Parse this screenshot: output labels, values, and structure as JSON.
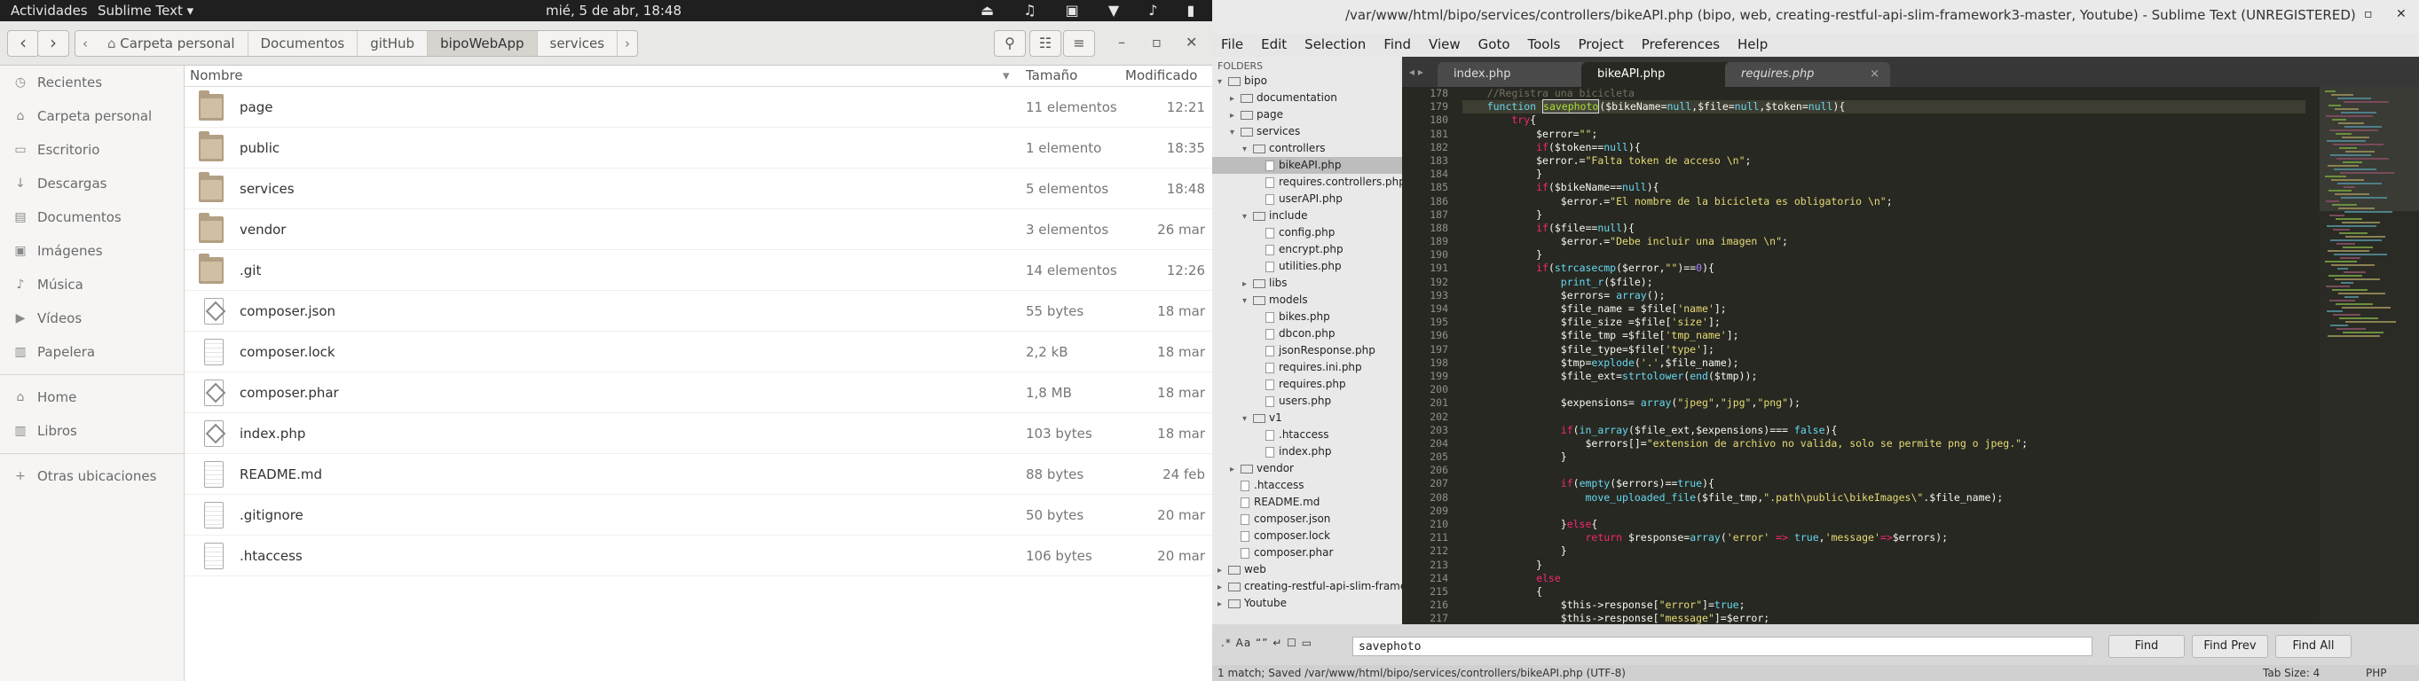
{
  "topbar": {
    "activities": "Actividades",
    "app_menu": "Sublime Text ▾",
    "clock": "mié,  5 de abr, 18:48",
    "tray_icons": [
      "bell-icon",
      "music-icon",
      "display-icon",
      "wifi-icon",
      "volume-icon",
      "battery-icon",
      "power-icon"
    ],
    "tray_glyphs": "⏏ ♫ ▣ ▼ ♪ ▮ ⏻"
  },
  "files": {
    "breadcrumbs": [
      "Carpeta personal",
      "Documentos",
      "gitHub",
      "bipoWebApp",
      "services"
    ],
    "active_crumb": "bipoWebApp",
    "sidebar": [
      {
        "icon": "clock-icon",
        "glyph": "◷",
        "label": "Recientes"
      },
      {
        "icon": "home-icon",
        "glyph": "⌂",
        "label": "Carpeta personal"
      },
      {
        "icon": "desktop-icon",
        "glyph": "▭",
        "label": "Escritorio"
      },
      {
        "icon": "download-icon",
        "glyph": "↓",
        "label": "Descargas"
      },
      {
        "icon": "document-icon",
        "glyph": "▤",
        "label": "Documentos"
      },
      {
        "icon": "image-icon",
        "glyph": "▣",
        "label": "Imágenes"
      },
      {
        "icon": "music-icon",
        "glyph": "♪",
        "label": "Música"
      },
      {
        "icon": "video-icon",
        "glyph": "▶",
        "label": "Vídeos"
      },
      {
        "icon": "trash-icon",
        "glyph": "▥",
        "label": "Papelera"
      },
      {
        "sep": true
      },
      {
        "icon": "home-icon",
        "glyph": "⌂",
        "label": "Home"
      },
      {
        "icon": "books-icon",
        "glyph": "▥",
        "label": "Libros"
      },
      {
        "sep": true
      },
      {
        "icon": "plus-icon",
        "glyph": "+",
        "label": "Otras ubicaciones"
      }
    ],
    "columns": {
      "name": "Nombre",
      "size": "Tamaño",
      "modified": "Modificado"
    },
    "rows": [
      {
        "name": "page",
        "size": "11 elementos",
        "modified": "12:21",
        "type": "folder"
      },
      {
        "name": "public",
        "size": "1 elemento",
        "modified": "18:35",
        "type": "folder"
      },
      {
        "name": "services",
        "size": "5 elementos",
        "modified": "18:48",
        "type": "folder"
      },
      {
        "name": "vendor",
        "size": "3 elementos",
        "modified": "26 mar",
        "type": "folder"
      },
      {
        "name": ".git",
        "size": "14 elementos",
        "modified": "12:26",
        "type": "folder"
      },
      {
        "name": "composer.json",
        "size": "55 bytes",
        "modified": "18 mar",
        "type": "code"
      },
      {
        "name": "composer.lock",
        "size": "2,2 kB",
        "modified": "18 mar",
        "type": "text"
      },
      {
        "name": "composer.phar",
        "size": "1,8 MB",
        "modified": "18 mar",
        "type": "code"
      },
      {
        "name": "index.php",
        "size": "103 bytes",
        "modified": "18 mar",
        "type": "code"
      },
      {
        "name": "README.md",
        "size": "88 bytes",
        "modified": "24 feb",
        "type": "text"
      },
      {
        "name": ".gitignore",
        "size": "50 bytes",
        "modified": "20 mar",
        "type": "text"
      },
      {
        "name": ".htaccess",
        "size": "106 bytes",
        "modified": "20 mar",
        "type": "text"
      }
    ]
  },
  "sublime": {
    "title": "/var/www/html/bipo/services/controllers/bikeAPI.php (bipo, web, creating-restful-api-slim-framework3-master, Youtube) - Sublime Text (UNREGISTERED)",
    "menu": [
      "File",
      "Edit",
      "Selection",
      "Find",
      "View",
      "Goto",
      "Tools",
      "Project",
      "Preferences",
      "Help"
    ],
    "folders_label": "FOLDERS",
    "tree": [
      {
        "d": 0,
        "k": "open",
        "label": "bipo"
      },
      {
        "d": 1,
        "k": "closed",
        "label": "documentation"
      },
      {
        "d": 1,
        "k": "closed",
        "label": "page"
      },
      {
        "d": 1,
        "k": "open",
        "label": "services"
      },
      {
        "d": 2,
        "k": "open",
        "label": "controllers"
      },
      {
        "d": 3,
        "k": "file",
        "label": "bikeAPI.php",
        "sel": true
      },
      {
        "d": 3,
        "k": "file",
        "label": "requires.controllers.php"
      },
      {
        "d": 3,
        "k": "file",
        "label": "userAPI.php"
      },
      {
        "d": 2,
        "k": "open",
        "label": "include"
      },
      {
        "d": 3,
        "k": "file",
        "label": "config.php"
      },
      {
        "d": 3,
        "k": "file",
        "label": "encrypt.php"
      },
      {
        "d": 3,
        "k": "file",
        "label": "utilities.php"
      },
      {
        "d": 2,
        "k": "closed",
        "label": "libs"
      },
      {
        "d": 2,
        "k": "open",
        "label": "models"
      },
      {
        "d": 3,
        "k": "file",
        "label": "bikes.php"
      },
      {
        "d": 3,
        "k": "file",
        "label": "dbcon.php"
      },
      {
        "d": 3,
        "k": "file",
        "label": "jsonResponse.php"
      },
      {
        "d": 3,
        "k": "file",
        "label": "requires.ini.php"
      },
      {
        "d": 3,
        "k": "file",
        "label": "requires.php"
      },
      {
        "d": 3,
        "k": "file",
        "label": "users.php"
      },
      {
        "d": 2,
        "k": "open",
        "label": "v1"
      },
      {
        "d": 3,
        "k": "file",
        "label": ".htaccess"
      },
      {
        "d": 3,
        "k": "file",
        "label": "index.php"
      },
      {
        "d": 1,
        "k": "closed",
        "label": "vendor"
      },
      {
        "d": 1,
        "k": "file",
        "label": ".htaccess"
      },
      {
        "d": 1,
        "k": "file",
        "label": "README.md"
      },
      {
        "d": 1,
        "k": "file",
        "label": "composer.json"
      },
      {
        "d": 1,
        "k": "file",
        "label": "composer.lock"
      },
      {
        "d": 1,
        "k": "file",
        "label": "composer.phar"
      },
      {
        "d": 0,
        "k": "closed",
        "label": "web"
      },
      {
        "d": 0,
        "k": "closed",
        "label": "creating-restful-api-slim-framework3-master"
      },
      {
        "d": 0,
        "k": "closed",
        "label": "Youtube"
      }
    ],
    "tabs": [
      {
        "label": "index.php",
        "active": false
      },
      {
        "label": "bikeAPI.php",
        "active": true
      },
      {
        "label": "requires.php",
        "active": false
      }
    ],
    "line_start": 178,
    "code": [
      [
        [
          "    ",
          "p"
        ],
        [
          "//Registra una bicicleta",
          "c"
        ]
      ],
      [
        [
          "    ",
          "p"
        ],
        [
          "function ",
          "b"
        ],
        [
          "savephoto",
          "g"
        ],
        [
          "($bikeName=",
          "p"
        ],
        [
          "null",
          "b"
        ],
        [
          ",$file=",
          "p"
        ],
        [
          "null",
          "b"
        ],
        [
          ",$token=",
          "p"
        ],
        [
          "null",
          "b"
        ],
        [
          "){",
          "p"
        ]
      ],
      [
        [
          "        try",
          "r"
        ],
        [
          "{",
          "p"
        ]
      ],
      [
        [
          "            $error=",
          "p"
        ],
        [
          "\"\"",
          "y"
        ],
        [
          ";",
          "p"
        ]
      ],
      [
        [
          "            if",
          "r"
        ],
        [
          "($token==",
          "p"
        ],
        [
          "null",
          "b"
        ],
        [
          "){",
          "p"
        ]
      ],
      [
        [
          "            $error.=",
          "p"
        ],
        [
          "\"Falta token de acceso \\n\"",
          "y"
        ],
        [
          ";",
          "p"
        ]
      ],
      [
        [
          "            }",
          "p"
        ]
      ],
      [
        [
          "            if",
          "r"
        ],
        [
          "($bikeName==",
          "p"
        ],
        [
          "null",
          "b"
        ],
        [
          "){",
          "p"
        ]
      ],
      [
        [
          "                $error.=",
          "p"
        ],
        [
          "\"El nombre de la bicicleta es obligatorio \\n\"",
          "y"
        ],
        [
          ";",
          "p"
        ]
      ],
      [
        [
          "            }",
          "p"
        ]
      ],
      [
        [
          "            if",
          "r"
        ],
        [
          "($file==",
          "p"
        ],
        [
          "null",
          "b"
        ],
        [
          "){",
          "p"
        ]
      ],
      [
        [
          "                $error.=",
          "p"
        ],
        [
          "\"Debe incluir una imagen \\n\"",
          "y"
        ],
        [
          ";",
          "p"
        ]
      ],
      [
        [
          "            }",
          "p"
        ]
      ],
      [
        [
          "            if",
          "r"
        ],
        [
          "(",
          "p"
        ],
        [
          "strcasecmp",
          "b"
        ],
        [
          "($error,",
          "p"
        ],
        [
          "\"\"",
          "y"
        ],
        [
          ")==",
          "p"
        ],
        [
          "0",
          "v"
        ],
        [
          "){",
          "p"
        ]
      ],
      [
        [
          "                ",
          "p"
        ],
        [
          "print_r",
          "b"
        ],
        [
          "($file);",
          "p"
        ]
      ],
      [
        [
          "                $errors= ",
          "p"
        ],
        [
          "array",
          "b"
        ],
        [
          "();",
          "p"
        ]
      ],
      [
        [
          "                $file_name = $file[",
          "p"
        ],
        [
          "'name'",
          "y"
        ],
        [
          "];",
          "p"
        ]
      ],
      [
        [
          "                $file_size =$file[",
          "p"
        ],
        [
          "'size'",
          "y"
        ],
        [
          "];",
          "p"
        ]
      ],
      [
        [
          "                $file_tmp =$file[",
          "p"
        ],
        [
          "'tmp_name'",
          "y"
        ],
        [
          "];",
          "p"
        ]
      ],
      [
        [
          "                $file_type=$file[",
          "p"
        ],
        [
          "'type'",
          "y"
        ],
        [
          "];",
          "p"
        ]
      ],
      [
        [
          "                $tmp=",
          "p"
        ],
        [
          "explode",
          "b"
        ],
        [
          "(",
          "p"
        ],
        [
          "'.'",
          "y"
        ],
        [
          ",$file_name);",
          "p"
        ]
      ],
      [
        [
          "                $file_ext=",
          "p"
        ],
        [
          "strtolower",
          "b"
        ],
        [
          "(",
          "p"
        ],
        [
          "end",
          "b"
        ],
        [
          "($tmp));",
          "p"
        ]
      ],
      [
        [
          "",
          "p"
        ]
      ],
      [
        [
          "                $expensions= ",
          "p"
        ],
        [
          "array",
          "b"
        ],
        [
          "(",
          "p"
        ],
        [
          "\"jpeg\"",
          "y"
        ],
        [
          ",",
          "p"
        ],
        [
          "\"jpg\"",
          "y"
        ],
        [
          ",",
          "p"
        ],
        [
          "\"png\"",
          "y"
        ],
        [
          ");",
          "p"
        ]
      ],
      [
        [
          "",
          "p"
        ]
      ],
      [
        [
          "                if",
          "r"
        ],
        [
          "(",
          "p"
        ],
        [
          "in_array",
          "b"
        ],
        [
          "($file_ext,$expensions)=== ",
          "p"
        ],
        [
          "false",
          "b"
        ],
        [
          "){",
          "p"
        ]
      ],
      [
        [
          "                    $errors[]=",
          "p"
        ],
        [
          "\"extension de archivo no valida, solo se permite png o jpeg.\"",
          "y"
        ],
        [
          ";",
          "p"
        ]
      ],
      [
        [
          "                }",
          "p"
        ]
      ],
      [
        [
          "",
          "p"
        ]
      ],
      [
        [
          "                if",
          "r"
        ],
        [
          "(",
          "p"
        ],
        [
          "empty",
          "b"
        ],
        [
          "($errors)==",
          "p"
        ],
        [
          "true",
          "b"
        ],
        [
          "){",
          "p"
        ]
      ],
      [
        [
          "                    ",
          "p"
        ],
        [
          "move_uploaded_file",
          "b"
        ],
        [
          "($file_tmp,",
          "p"
        ],
        [
          "\".path\\public\\bikeImages\\\"",
          "y"
        ],
        [
          ".$file_name);",
          "p"
        ]
      ],
      [
        [
          "",
          "p"
        ]
      ],
      [
        [
          "                }",
          "p"
        ],
        [
          "else",
          "r"
        ],
        [
          "{",
          "p"
        ]
      ],
      [
        [
          "                    ",
          "p"
        ],
        [
          "return ",
          "r"
        ],
        [
          "$response=",
          "p"
        ],
        [
          "array",
          "b"
        ],
        [
          "(",
          "p"
        ],
        [
          "'error'",
          "y"
        ],
        [
          " => ",
          "r"
        ],
        [
          "true",
          "b"
        ],
        [
          ",",
          "p"
        ],
        [
          "'message'",
          "y"
        ],
        [
          "=>",
          "r"
        ],
        [
          "$errors);",
          "p"
        ]
      ],
      [
        [
          "                }",
          "p"
        ]
      ],
      [
        [
          "            }",
          "p"
        ]
      ],
      [
        [
          "            else",
          "r"
        ]
      ],
      [
        [
          "            {",
          "p"
        ]
      ],
      [
        [
          "                $this->response[",
          "p"
        ],
        [
          "\"error\"",
          "y"
        ],
        [
          "]=",
          "p"
        ],
        [
          "true",
          "b"
        ],
        [
          ";",
          "p"
        ]
      ],
      [
        [
          "                $this->response[",
          "p"
        ],
        [
          "\"message\"",
          "y"
        ],
        [
          "]=$error;",
          "p"
        ]
      ],
      [
        [
          "            }",
          "p"
        ]
      ]
    ],
    "find": {
      "options": ".*  Aa  “”  ↵  ☐  ▭",
      "query": "savephoto",
      "find": "Find",
      "find_prev": "Find Prev",
      "find_all": "Find All"
    },
    "status": {
      "message": "1 match; Saved /var/www/html/bipo/services/controllers/bikeAPI.php (UTF-8)",
      "tab_size": "Tab Size: 4",
      "syntax": "PHP"
    },
    "colors": {
      "p": "#f8f8f2",
      "c": "#75715e",
      "b": "#66d9ef",
      "r": "#f92672",
      "y": "#e6db74",
      "g": "#a6e22e",
      "v": "#ae81ff"
    }
  }
}
